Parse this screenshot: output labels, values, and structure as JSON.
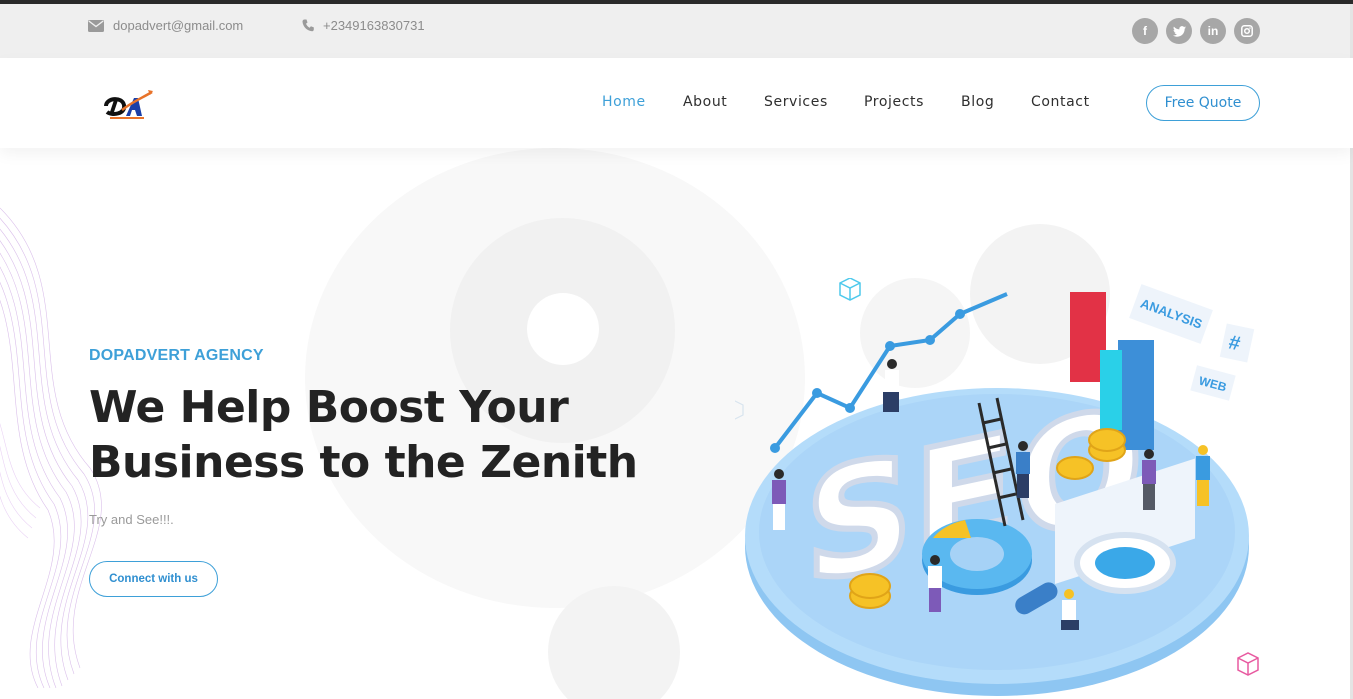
{
  "topbar": {
    "email": "dopadvert@gmail.com",
    "phone": "+2349163830731",
    "email_icon": "envelope-icon",
    "phone_icon": "phone-icon",
    "social": [
      {
        "icon": "facebook-icon",
        "glyph": "f"
      },
      {
        "icon": "twitter-icon",
        "glyph": "t"
      },
      {
        "icon": "linkedin-icon",
        "glyph": "in"
      },
      {
        "icon": "instagram-icon",
        "glyph": "◙"
      }
    ]
  },
  "header": {
    "logo_text": "DA",
    "nav": [
      {
        "label": "Home",
        "active": true
      },
      {
        "label": "About",
        "active": false
      },
      {
        "label": "Services",
        "active": false
      },
      {
        "label": "Projects",
        "active": false
      },
      {
        "label": "Blog",
        "active": false
      },
      {
        "label": "Contact",
        "active": false
      }
    ],
    "cta_label": "Free Quote"
  },
  "hero": {
    "eyebrow": "DOPADVERT AGENCY",
    "headline_line1": "We Help Boost Your",
    "headline_line2": "Business to the Zenith",
    "tagline": "Try and See!!!.",
    "button_label": "Connect with us",
    "illustration": {
      "big_text": "SEO",
      "tags": [
        "ANALYSIS",
        "#",
        "WEB"
      ]
    }
  },
  "colors": {
    "accent": "#3ea0d8",
    "topbar_bg": "#efefef",
    "headline": "#232323",
    "social_bg": "#a7a7a7"
  }
}
